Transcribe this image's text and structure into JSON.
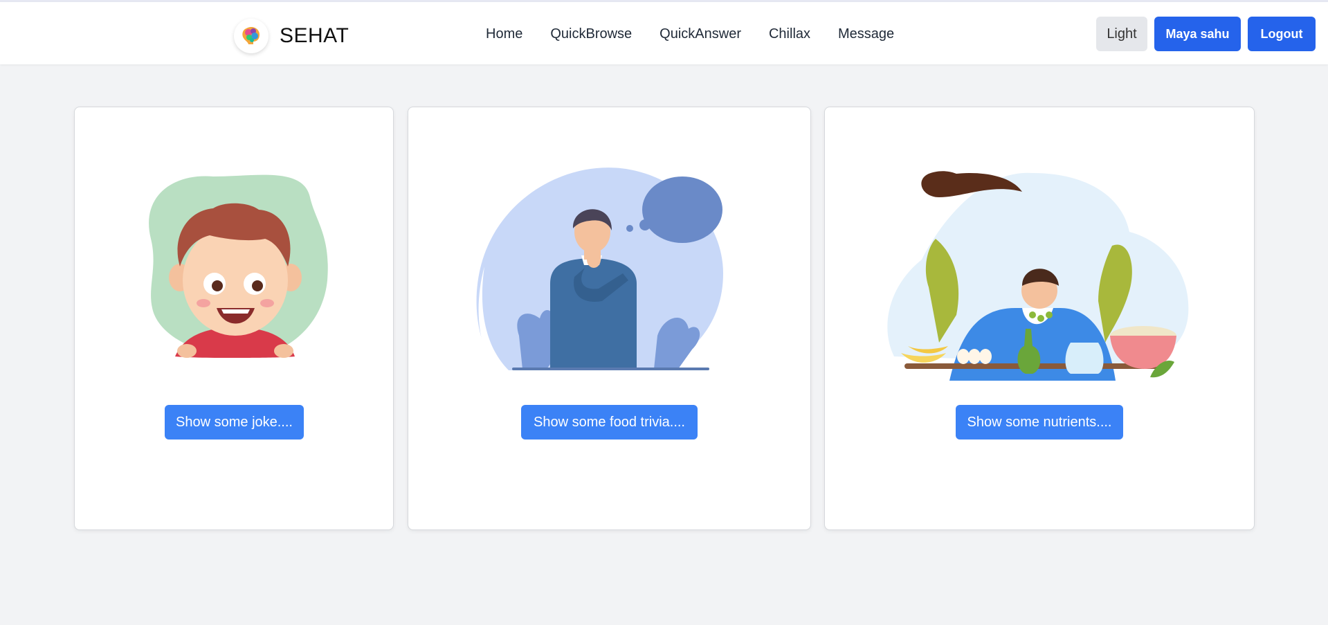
{
  "header": {
    "brand": "SEHAT",
    "nav": [
      "Home",
      "QuickBrowse",
      "QuickAnswer",
      "Chillax",
      "Message"
    ],
    "theme_toggle": "Light",
    "user": "Maya sahu",
    "logout": "Logout"
  },
  "cards": [
    {
      "illustration": "smiling-boy-illustration",
      "button": "Show some joke...."
    },
    {
      "illustration": "thinking-man-illustration",
      "button": "Show some food trivia...."
    },
    {
      "illustration": "woman-with-healthy-food-illustration",
      "button": "Show some nutrients...."
    }
  ],
  "colors": {
    "primary": "#2563eb",
    "card_button": "#3b82f6",
    "page_bg": "#f2f3f5",
    "card_bg": "#ffffff"
  }
}
